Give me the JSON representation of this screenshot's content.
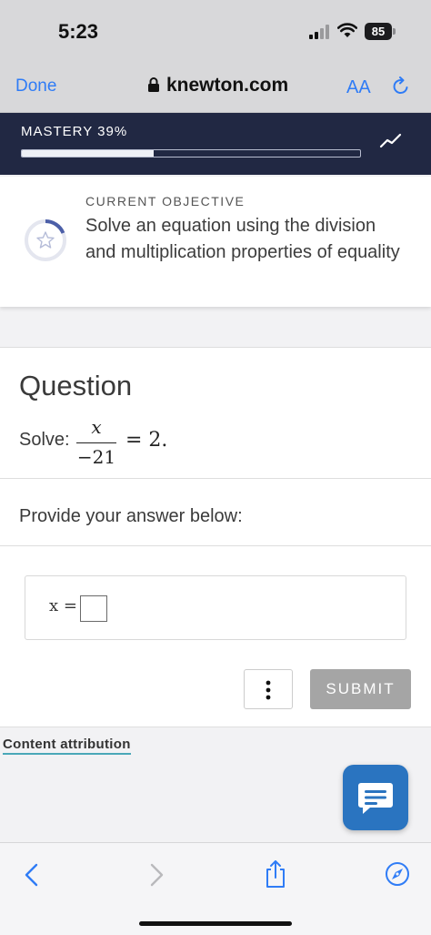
{
  "status_bar": {
    "time": "5:23",
    "battery": "85"
  },
  "browser": {
    "done_label": "Done",
    "domain": "knewton.com",
    "text_size_label": "AA"
  },
  "mastery": {
    "label": "MASTERY  39%",
    "percent": 39
  },
  "objective": {
    "label": "CURRENT OBJECTIVE",
    "text": "Solve an equation using the division and multiplication properties of equality"
  },
  "question": {
    "title": "Question",
    "solve_label": "Solve:",
    "fraction_numerator": "x",
    "fraction_denominator": "−21",
    "equation_rhs": "= 2.",
    "provide_label": "Provide your answer below:",
    "answer_variable": "x ="
  },
  "actions": {
    "more_label": "⋮",
    "submit_label": "SUBMIT"
  },
  "footer": {
    "attribution_label": "Content attribution"
  },
  "colors": {
    "accent": "#2f7cf6",
    "mastery_bg": "#212843",
    "chat_button": "#2a74c0",
    "submit_disabled": "#a5a5a5"
  },
  "icons": [
    "lock-icon",
    "reload-icon",
    "trend-icon",
    "star-icon",
    "chat-icon",
    "back-icon",
    "forward-icon",
    "share-icon",
    "compass-icon"
  ]
}
